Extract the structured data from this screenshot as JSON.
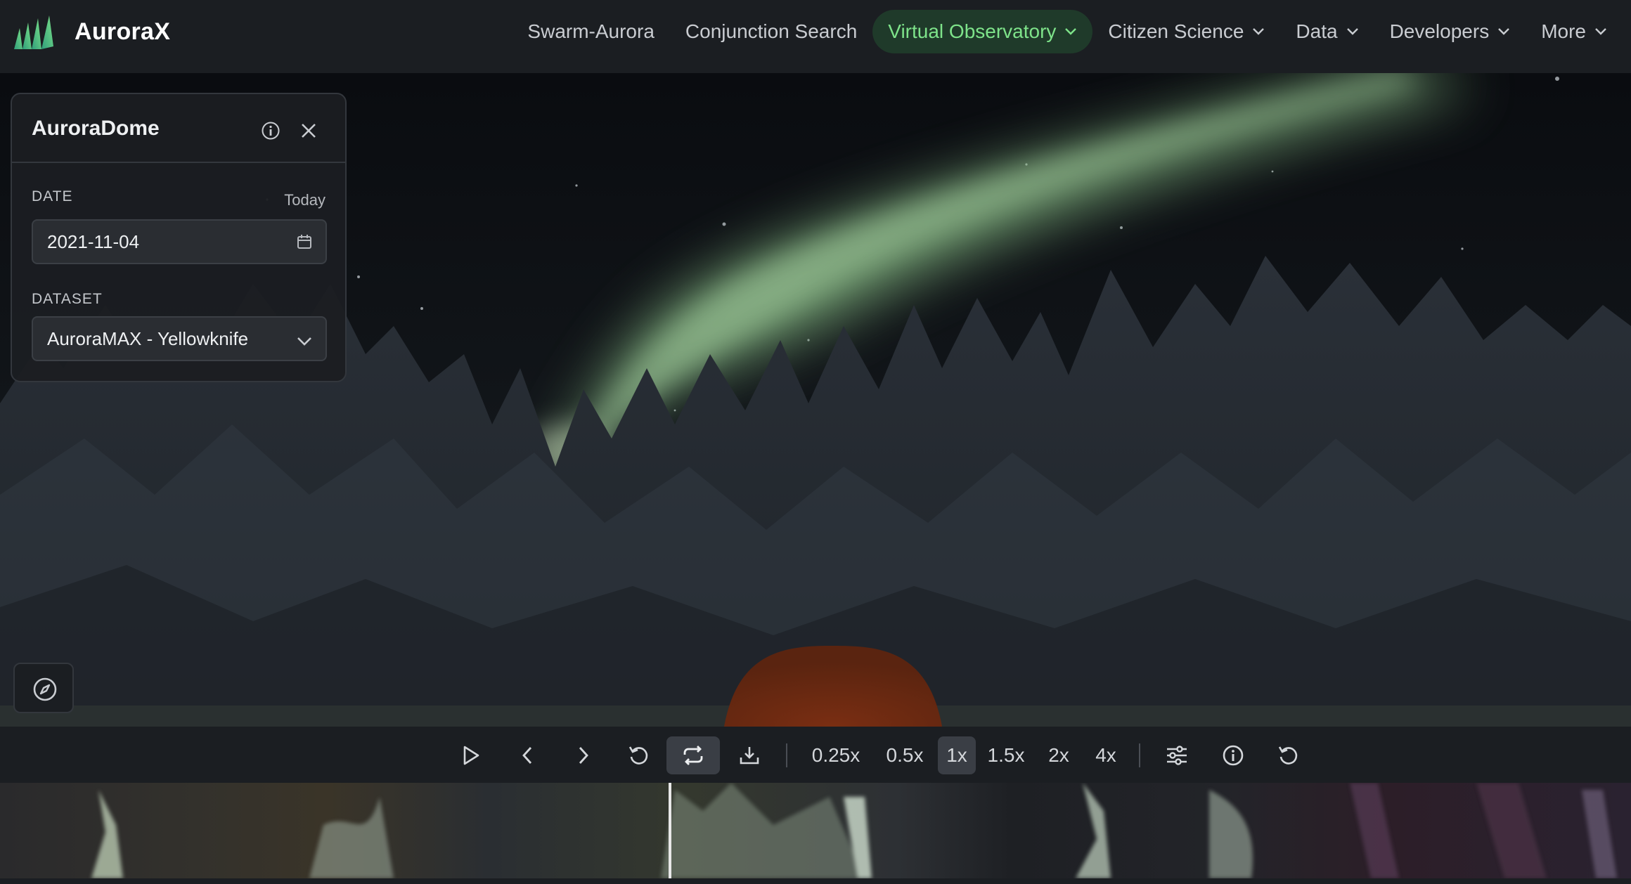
{
  "brand": {
    "name": "AuroraX",
    "logo_icon": "aurorax-logo-icon"
  },
  "nav": {
    "items": [
      {
        "label": "Swarm-Aurora",
        "has_dropdown": false,
        "active": false
      },
      {
        "label": "Conjunction Search",
        "has_dropdown": false,
        "active": false
      },
      {
        "label": "Virtual Observatory",
        "has_dropdown": true,
        "active": true
      },
      {
        "label": "Citizen Science",
        "has_dropdown": true,
        "active": false
      },
      {
        "label": "Data",
        "has_dropdown": true,
        "active": false
      },
      {
        "label": "Developers",
        "has_dropdown": true,
        "active": false
      },
      {
        "label": "More",
        "has_dropdown": true,
        "active": false
      }
    ]
  },
  "panel": {
    "title": "AuroraDome",
    "date_label": "DATE",
    "today_label": "Today",
    "date_value": "2021-11-04",
    "dataset_label": "DATASET",
    "dataset_value": "AuroraMAX - Yellowknife"
  },
  "playback": {
    "speeds": [
      "0.25x",
      "0.5x",
      "1x",
      "1.5x",
      "2x",
      "4x"
    ],
    "selected_speed": "1x",
    "loop_enabled": true,
    "progress": 0.41
  },
  "colors": {
    "accent": "#7ee38a",
    "active_nav_bg": "#1f3a2a",
    "bar_bg": "#1b1e22"
  }
}
